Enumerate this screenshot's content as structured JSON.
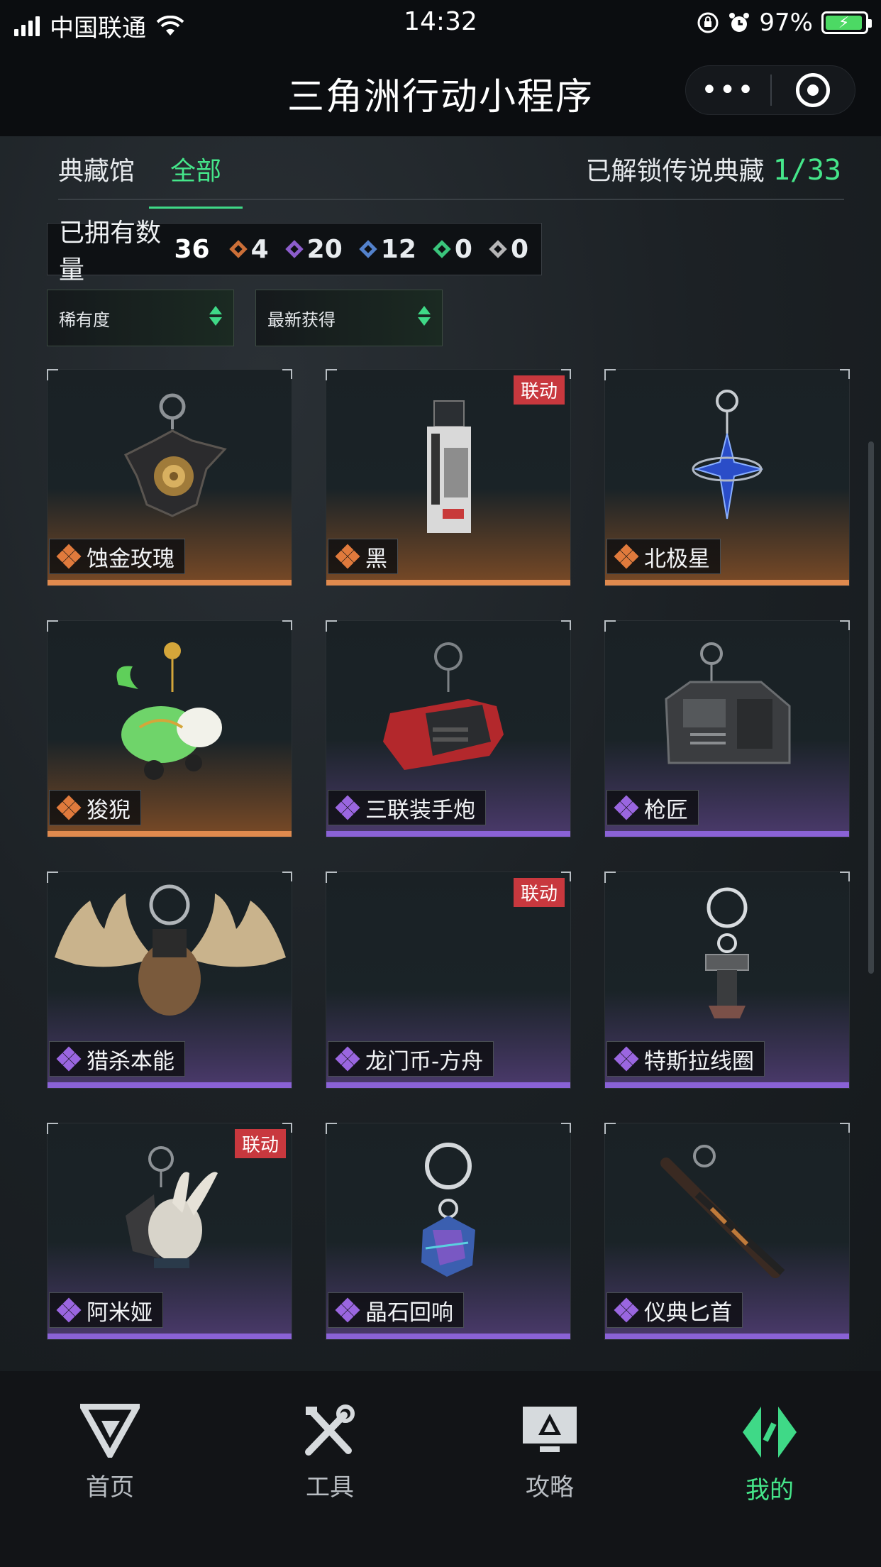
{
  "status_bar": {
    "carrier": "中国联通",
    "time": "14:32",
    "battery": "97%"
  },
  "title_bar": {
    "title": "三角洲行动小程序",
    "more": "•••"
  },
  "tabs": [
    {
      "label": "典藏馆"
    },
    {
      "label": "全部"
    }
  ],
  "unlocked": {
    "label": "已解锁传说典藏",
    "count": "1/33"
  },
  "owned": {
    "label": "已拥有数量",
    "total": "36",
    "stats": [
      {
        "value": "4",
        "color": "#e07a3c"
      },
      {
        "value": "20",
        "color": "#9a66e0"
      },
      {
        "value": "12",
        "color": "#5b8fe0"
      },
      {
        "value": "0",
        "color": "#3fd987"
      },
      {
        "value": "0",
        "color": "#c8c8c8"
      }
    ]
  },
  "filters": {
    "rarity": "稀有度",
    "sort": "最新获得"
  },
  "items": [
    {
      "name": "蚀金玫瑰",
      "rarity": "gold",
      "badge": "",
      "icon": "rose-charm-icon"
    },
    {
      "name": "黑",
      "rarity": "gold",
      "badge": "联动",
      "icon": "poster-charm-icon"
    },
    {
      "name": "北极星",
      "rarity": "gold",
      "badge": "",
      "icon": "star-charm-icon"
    },
    {
      "name": "狻猊",
      "rarity": "gold",
      "badge": "",
      "icon": "lion-charm-icon"
    },
    {
      "name": "三联装手炮",
      "rarity": "purple",
      "badge": "",
      "icon": "cannon-charm-icon"
    },
    {
      "name": "枪匠",
      "rarity": "purple",
      "badge": "",
      "icon": "gunsmith-charm-icon"
    },
    {
      "name": "猎杀本能",
      "rarity": "purple",
      "badge": "",
      "icon": "antler-charm-icon"
    },
    {
      "name": "龙门币-方舟",
      "rarity": "purple",
      "badge": "联动",
      "icon": "coin-charm-icon"
    },
    {
      "name": "特斯拉线圈",
      "rarity": "purple",
      "badge": "",
      "icon": "coil-charm-icon"
    },
    {
      "name": "阿米娅",
      "rarity": "purple",
      "badge": "联动",
      "icon": "amiya-charm-icon"
    },
    {
      "name": "晶石回响",
      "rarity": "purple",
      "badge": "",
      "icon": "crystal-charm-icon"
    },
    {
      "name": "仪典匕首",
      "rarity": "purple",
      "badge": "",
      "icon": "dagger-charm-icon"
    }
  ],
  "rarity_colors": {
    "gold": "#e07a3c",
    "purple": "#9a66e0"
  },
  "bottom_nav": [
    {
      "label": "首页",
      "icon": "home-logo-icon"
    },
    {
      "label": "工具",
      "icon": "tools-icon"
    },
    {
      "label": "攻略",
      "icon": "guide-monitor-icon"
    },
    {
      "label": "我的",
      "icon": "profile-logo-icon",
      "active": true
    }
  ]
}
